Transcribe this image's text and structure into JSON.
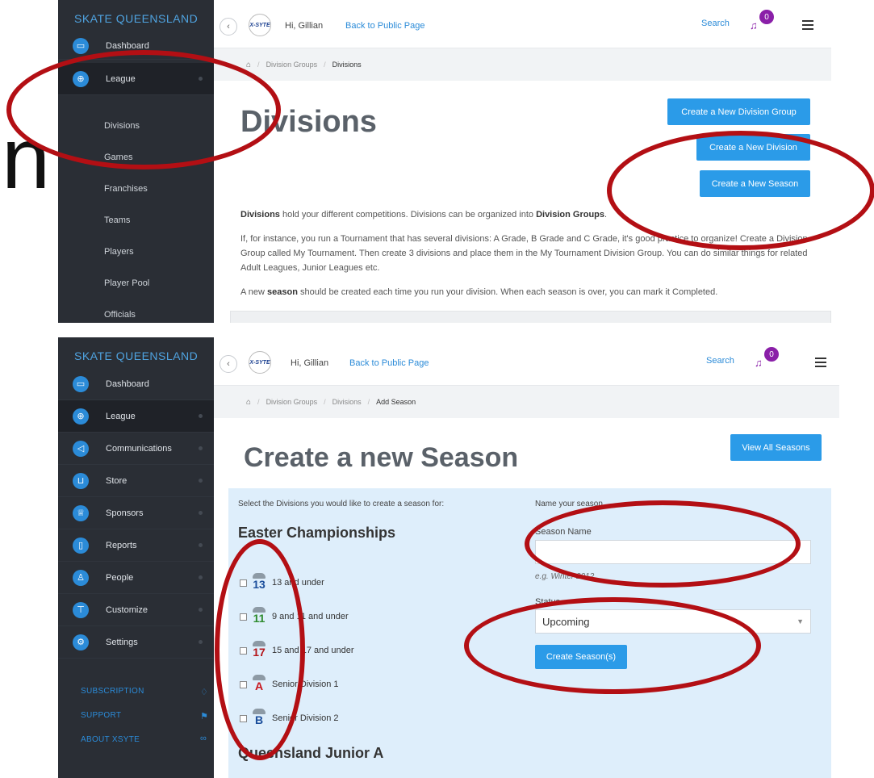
{
  "annotation": {
    "big_letter": "n"
  },
  "app": {
    "brand": "SKATE QUEENSLAND",
    "logo_text": "X-SYTE",
    "greeting": "Hi, Gillian",
    "public_link": "Back to Public Page",
    "search": "Search",
    "notifications": "0"
  },
  "colors": {
    "sidebar": "#2a2e35",
    "accent": "#2b9be8",
    "badge": "#8a1fa8",
    "panel": "#deeefb",
    "annotation_ring": "#b30f14"
  },
  "shot1": {
    "sidebar": {
      "dashboard_partial": "Dashboard",
      "league": "League",
      "sub_items": [
        "Divisions",
        "Games",
        "Franchises",
        "Teams",
        "Players",
        "Player Pool",
        "Officials"
      ]
    },
    "breadcrumb": [
      "Division Groups",
      "Divisions"
    ],
    "title": "Divisions",
    "buttons": {
      "new_group": "Create a New Division Group",
      "new_division": "Create a New Division",
      "new_season": "Create a New Season"
    },
    "para1_bold1": "Divisions",
    "para1_mid": " hold your different competitions. Divisions can be organized into ",
    "para1_bold2": "Division Groups",
    "para1_end": ".",
    "para2": "If, for instance, you run a Tournament that has several divisions: A Grade, B Grade and C Grade, it's good practice to organize! Create a Division Group called My Tournament. Then create 3 divisions and place them in the My Tournament Division Group. You can do similar things for related Adult Leagues, Junior Leagues etc.",
    "para3_start": "A new ",
    "para3_bold": "season",
    "para3_end": " should be created each time you run your division. When each season is over, you can mark it Completed."
  },
  "shot2": {
    "sidebar": {
      "items": [
        "Dashboard",
        "League",
        "Communications",
        "Store",
        "Sponsors",
        "Reports",
        "People",
        "Customize",
        "Settings"
      ],
      "footer": [
        "SUBSCRIPTION",
        "SUPPORT",
        "ABOUT XSYTE"
      ]
    },
    "breadcrumb": [
      "Division Groups",
      "Divisions",
      "Add Season"
    ],
    "title": "Create a new Season",
    "view_all": "View All Seasons",
    "select_label": "Select the Divisions you would like to create a season for:",
    "name_label": "Name your season",
    "group_title": "Easter Championships",
    "divisions": [
      {
        "icon_text": "13",
        "label": "13 and under"
      },
      {
        "icon_text": "11",
        "label": "9 and 11 and under"
      },
      {
        "icon_text": "17",
        "label": "15 and 17 and under"
      },
      {
        "icon_text": "A",
        "label": "Senior Division 1"
      },
      {
        "icon_text": "B",
        "label": "Senior Division 2"
      }
    ],
    "season_name_label": "Season Name",
    "season_hint": "e.g. Winter 2012",
    "status_label": "Status",
    "status_value": "Upcoming",
    "create_button": "Create Season(s)",
    "next_group": "Queensland Junior A"
  }
}
